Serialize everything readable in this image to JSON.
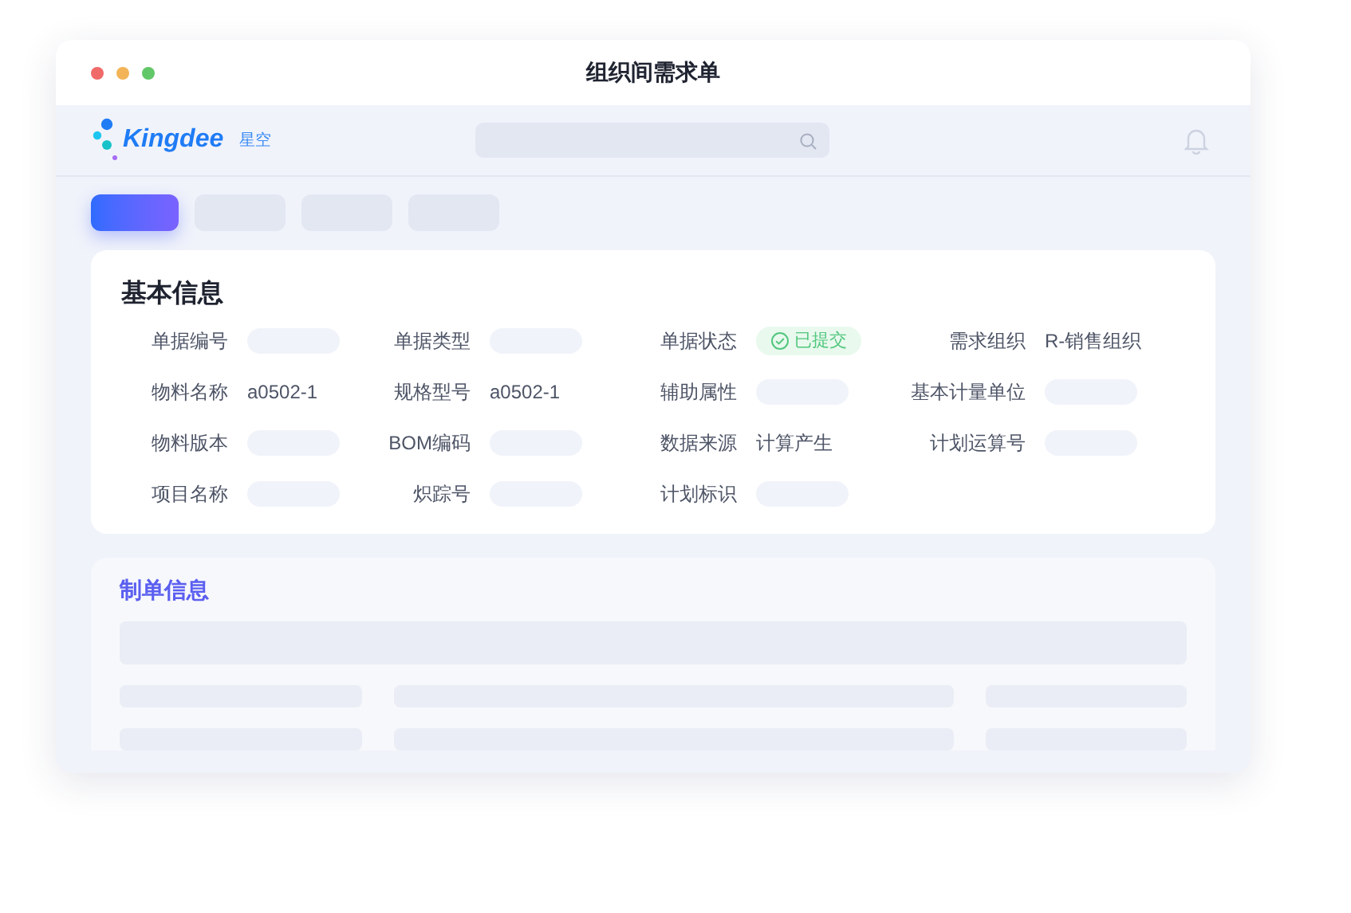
{
  "window": {
    "title": "组织间需求单"
  },
  "header": {
    "logo_text": "Kingdee",
    "logo_sub": "星空"
  },
  "toolbar": [
    {
      "selected": true
    },
    {
      "selected": false
    },
    {
      "selected": false
    },
    {
      "selected": false
    }
  ],
  "basic_info": {
    "title": "基本信息",
    "fields": [
      {
        "label": "单据编号",
        "kind": "blank"
      },
      {
        "label": "单据类型",
        "kind": "blank"
      },
      {
        "label": "单据状态",
        "kind": "status",
        "value": "已提交"
      },
      {
        "label": "需求组织",
        "kind": "text",
        "value": "R-销售组织"
      },
      {
        "label": "物料名称",
        "kind": "text",
        "value": "a0502-1"
      },
      {
        "label": "规格型号",
        "kind": "text",
        "value": "a0502-1"
      },
      {
        "label": "辅助属性",
        "kind": "blank"
      },
      {
        "label": "基本计量单位",
        "kind": "blank"
      },
      {
        "label": "物料版本",
        "kind": "blank"
      },
      {
        "label": "BOM编码",
        "kind": "blank"
      },
      {
        "label": "数据来源",
        "kind": "text",
        "value": "计算产生"
      },
      {
        "label": "计划运算号",
        "kind": "blank"
      },
      {
        "label": "项目名称",
        "kind": "blank"
      },
      {
        "label": "炽踪号",
        "kind": "blank"
      },
      {
        "label": "计划标识",
        "kind": "blank"
      }
    ]
  },
  "making_info": {
    "title": "制单信息"
  }
}
